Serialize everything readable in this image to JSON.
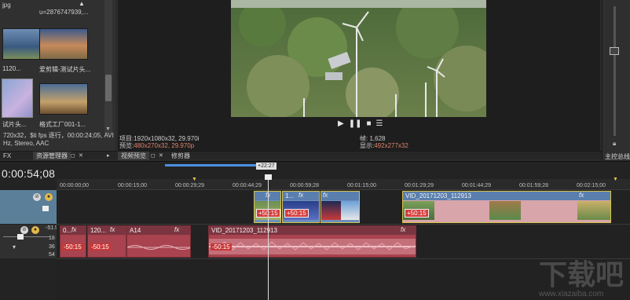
{
  "media": {
    "top_labels": [
      "jpg",
      "u=2876747939,..."
    ],
    "items": [
      {
        "caption": "1120...",
        "thumb": "media-thumb-1"
      },
      {
        "caption": "爱剪辑-测试片头...",
        "thumb": "media-thumb-2"
      },
      {
        "caption": "试片头...",
        "thumb": "media-thumb-3"
      },
      {
        "caption": "格式工厂001-1...",
        "thumb": "media-thumb-4"
      }
    ],
    "info_lines": [
      "720x32，$ti fps 逐行，00:00:24;05, AVI",
      "Hz, Stereo, AAC"
    ],
    "fx_label": "FX"
  },
  "tabs": {
    "media_manager": "资源管理器",
    "preview": "视频预览",
    "trimmer": "修剪器"
  },
  "preview": {
    "transport": {
      "play": "▶",
      "pause": "❚❚",
      "stop": "■",
      "menu": "☰"
    },
    "project_label": "项目:",
    "project_value": "1920x1080x32, 29.970i",
    "preview_label": "预览:",
    "preview_value": "480x270x32, 29.970p",
    "frame_label": "帧:",
    "frame_value": "1,628",
    "display_label": "显示:",
    "display_value": "492x277x32"
  },
  "right_panel": {
    "master_label": "主控总线"
  },
  "timeline": {
    "timecode": "0:00:54;08",
    "region_label": "+22:27",
    "ruler_ticks": [
      "00:00:00;00",
      "00:00:15;00",
      "00:00:29;29",
      "00:00:44;29",
      "00:00:59;28",
      "00:01:15;00",
      "00:01:29;29",
      "00:01:44;29",
      "00:01:59;28",
      "00:02:15;00"
    ],
    "audio_track": {
      "level": "-51.9",
      "scale": [
        "18",
        "36",
        "54"
      ]
    },
    "video_clips": [
      {
        "label": "",
        "gain": "+50:15"
      },
      {
        "label": "1...",
        "gain": "+50:15"
      },
      {
        "label": "",
        "gain": ""
      },
      {
        "label": "VID_20171203_112913",
        "gain": "+50:15"
      }
    ],
    "audio_clips": [
      {
        "label": "0...",
        "gain": "-50:15"
      },
      {
        "label": "120...",
        "gain": "-50:15"
      },
      {
        "label": "A14",
        "gain": ""
      },
      {
        "label": "VID_20171203_112913",
        "gain": "-50:15"
      }
    ],
    "fx": "fx"
  },
  "watermark": {
    "brand": "下载吧",
    "url": "www.xiazaiba.com"
  }
}
